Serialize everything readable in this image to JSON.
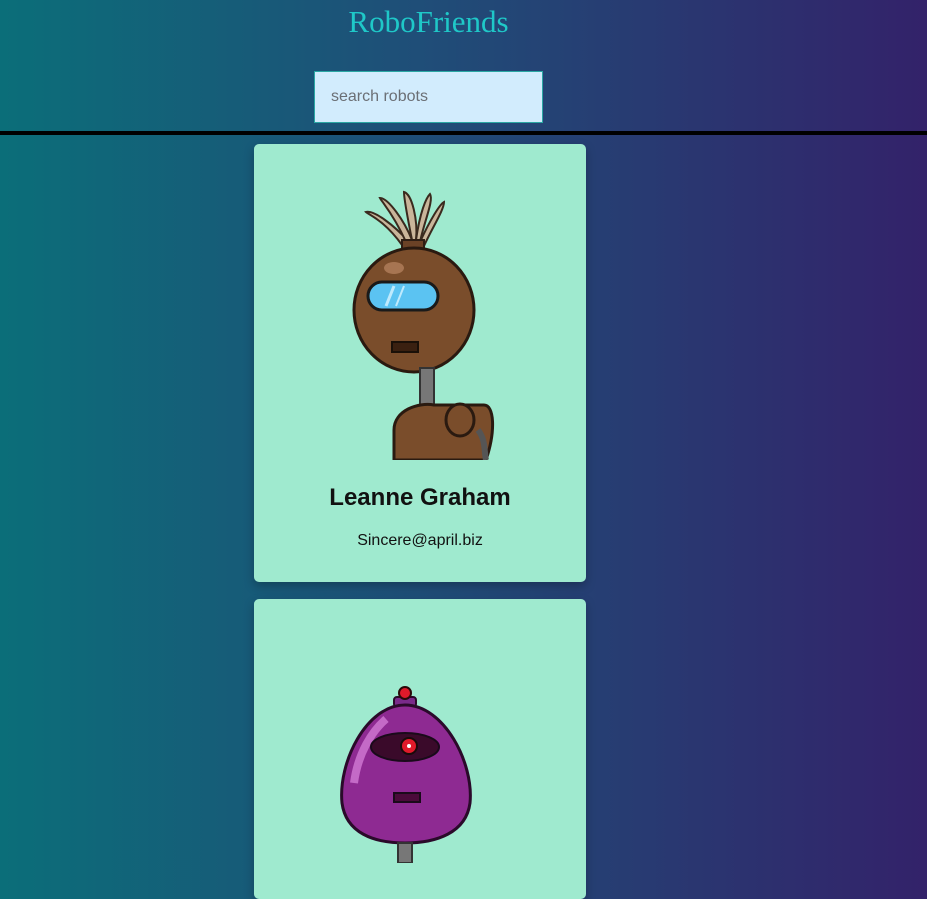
{
  "header": {
    "title": "RoboFriends"
  },
  "search": {
    "placeholder": "search robots",
    "value": ""
  },
  "robots": [
    {
      "name": "Leanne Graham",
      "email": "Sincere@april.biz",
      "avatar": "brown-robot-avatar"
    },
    {
      "name": "",
      "email": "",
      "avatar": "purple-robot-avatar"
    }
  ],
  "colors": {
    "background_left": "#0b6e79",
    "background_right": "#33226a",
    "title": "#1fc8c8",
    "card": "#9feacf",
    "search_bg": "#d2ecfd"
  }
}
